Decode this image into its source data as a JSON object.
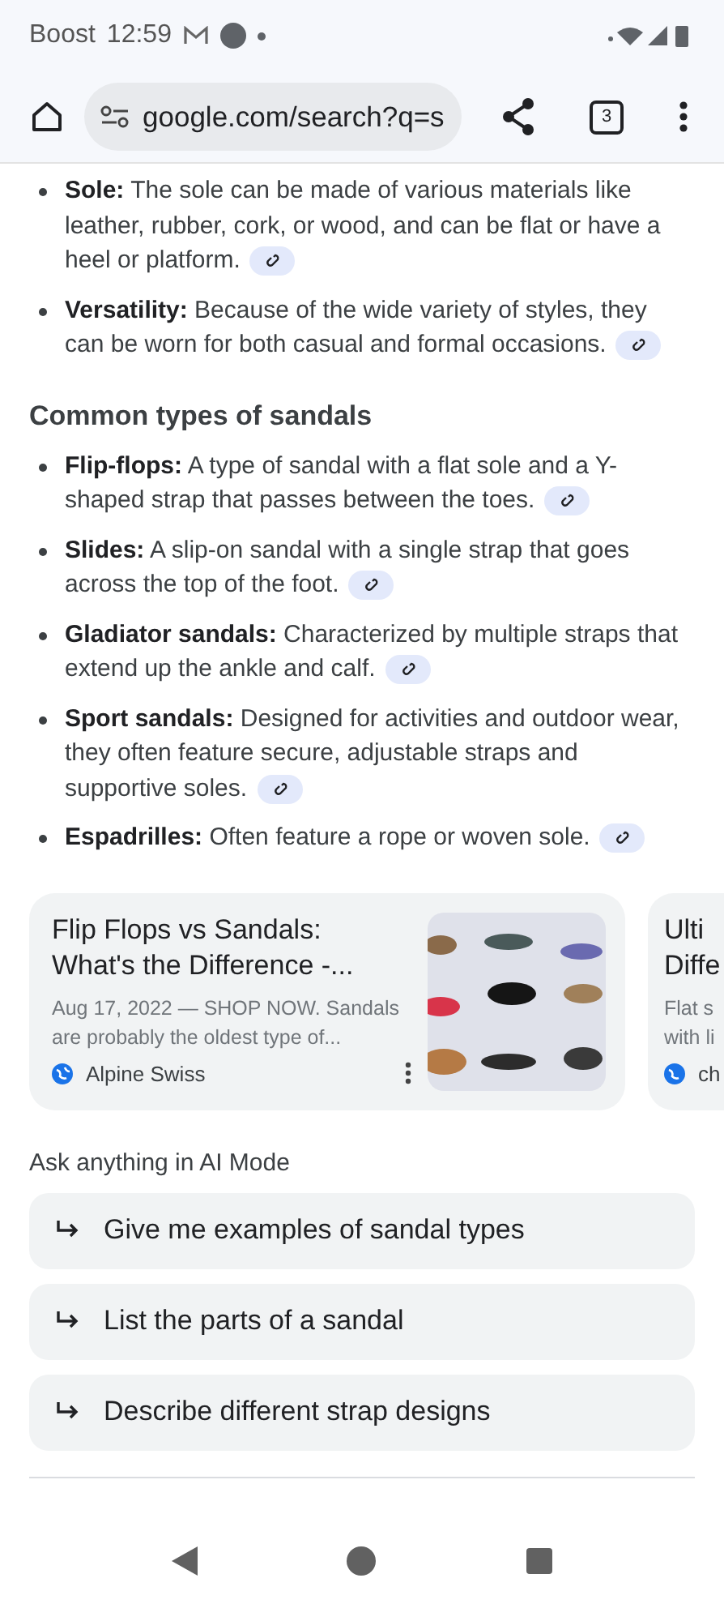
{
  "status_bar": {
    "carrier": "Boost",
    "time": "12:59"
  },
  "toolbar": {
    "url": "google.com/search?q=s",
    "tab_count": "3"
  },
  "intro_bullets": [
    {
      "text": "**Sole:** The sole can be made of various materials like leather, rubber, cork, or wood, and can be flat or have a heel or platform."
    },
    {
      "text": "**Versatility:** Because of the wide variety of styles, they can be worn for both casual and formal occasions."
    }
  ],
  "section": {
    "heading": "Common types of sandals",
    "bullets": [
      {
        "text": "**Flip-flops:** A type of sandal with a flat sole and a Y-shaped strap that passes between the toes."
      },
      {
        "text": "**Slides:** A slip-on sandal with a single strap that goes across the top of the foot."
      },
      {
        "text": "**Gladiator sandals:** Characterized by multiple straps that extend up the ankle and calf."
      },
      {
        "text": "**Sport sandals:** Designed for activities and outdoor wear, they often feature secure, adjustable straps and supportive soles."
      },
      {
        "text": "**Espadrilles:** Often feature a rope or woven sole."
      }
    ]
  },
  "cards": [
    {
      "title": "Flip Flops vs Sandals: What's the Difference -...",
      "snippet": "Aug 17, 2022 — SHOP NOW. Sandals are probably the oldest type of...",
      "source": "Alpine Swiss",
      "kind": "full"
    },
    {
      "title_lines": [
        "Ulti",
        "Diffe"
      ],
      "snippet_lines": [
        "Flat s",
        "with li"
      ],
      "source": "ch",
      "kind": "partial"
    }
  ],
  "ai_mode": {
    "heading": "Ask anything in AI Mode",
    "suggestions": [
      "Give me examples of sandal types",
      "List the parts of a sandal",
      "Describe different strap designs"
    ]
  }
}
